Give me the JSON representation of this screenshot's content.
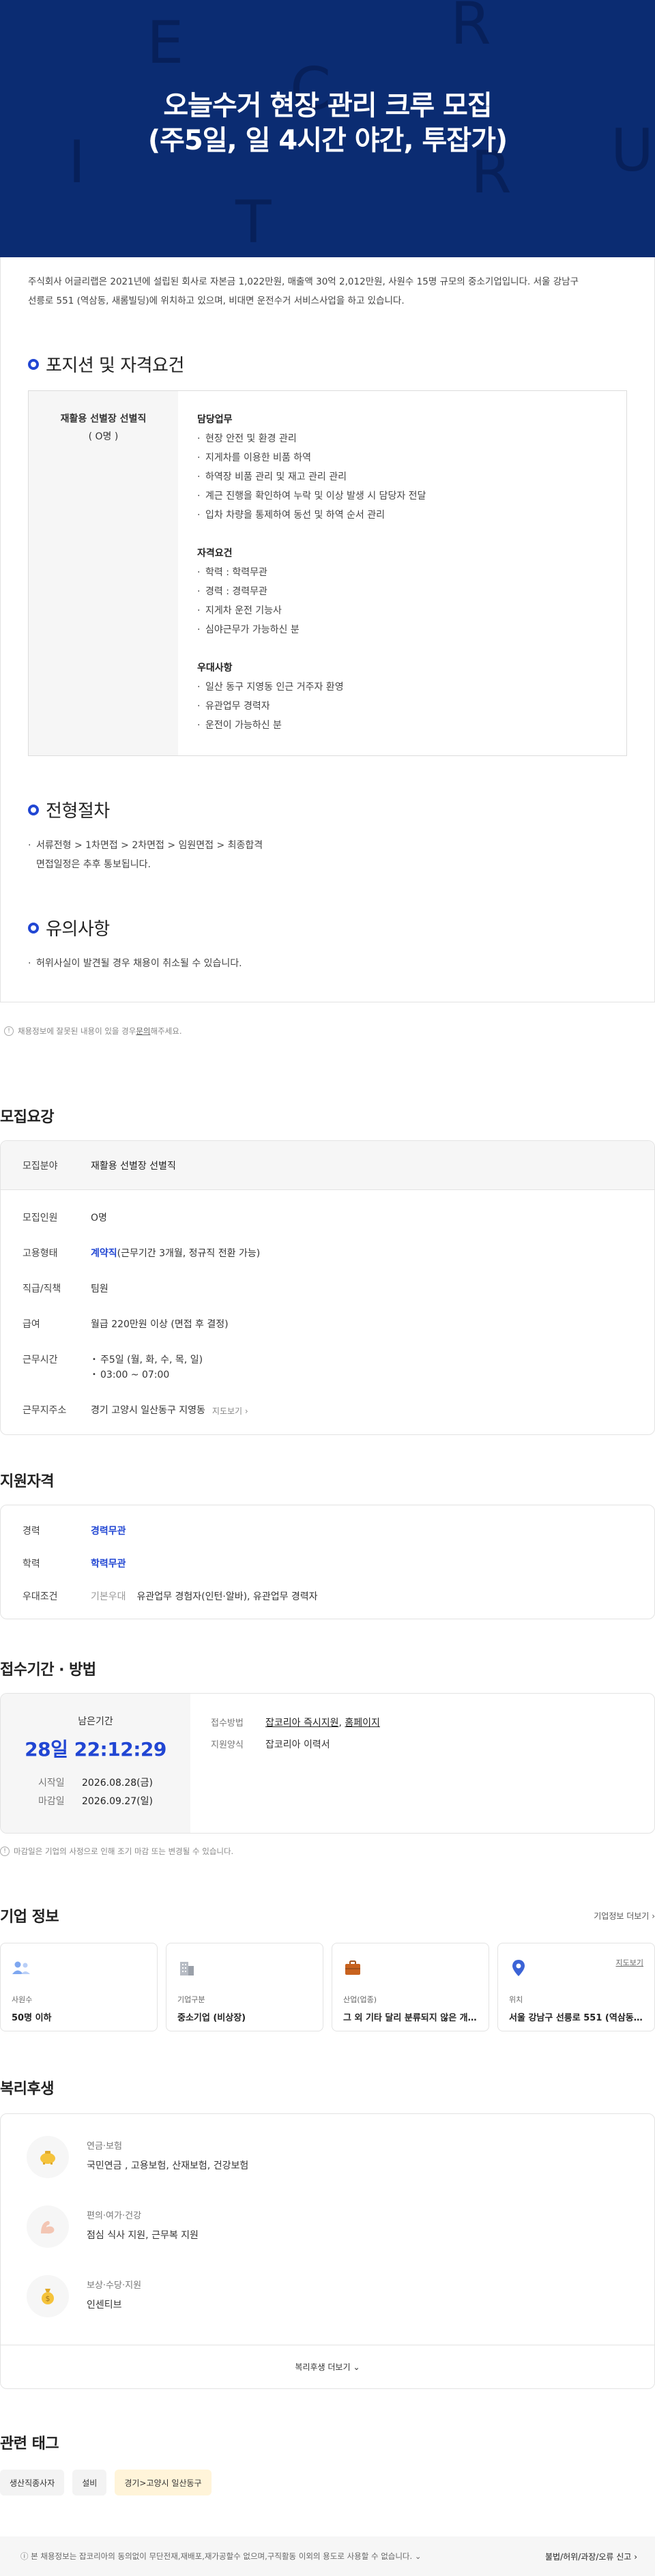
{
  "hero": {
    "title_line1": "오늘수거 현장 관리 크루 모집",
    "title_line2": "(주5일, 일 4시간 야간, 투잡가)",
    "deco_letters": [
      "E",
      "R",
      "C",
      "U",
      "I",
      "R",
      "T"
    ],
    "colors": {
      "background": "#0b2c72",
      "letters": "#07205a"
    }
  },
  "intro": {
    "line1": "주식회사 어글리랩은 2021년에 설립된 회사로 자본금 1,022만원, 매출액 30억 2,012만원, 사원수 15명 규모의 중소기업입니다. 서울 강남구",
    "line2": "선릉로 551 (역삼동, 새롬빌딩)에 위치하고 있으며, 비대면 운전수거 서비스사업을 하고 있습니다."
  },
  "position": {
    "heading": "포지션 및 자격요건",
    "job_title": "재활용 선별장 선별직",
    "headcount": "( O명 )",
    "groups": [
      {
        "title": "담당업무",
        "items": [
          "현장 안전 및 환경 관리",
          "지게차를 이용한 비품 하역",
          "하역장 비품 관리 및 재고 관리 관리",
          "계근 진행을 확인하여 누락 및 이상 발생 시 담당자 전달",
          "입차 차량을 통제하여 동선 및 하역 순서 관리"
        ]
      },
      {
        "title": "자격요건",
        "items": [
          "학력 : 학력무관",
          "경력 : 경력무관",
          "지게차 운전 기능사",
          "심야근무가 가능하신 분"
        ]
      },
      {
        "title": "우대사항",
        "items": [
          "일산 동구 지영동 인근 거주자 환영",
          "유관업무 경력자",
          "운전이 가능하신 분"
        ]
      }
    ]
  },
  "process": {
    "heading": "전형절차",
    "items": [
      "서류전형 > 1차면접 > 2차면접 > 임원면접 > 최종합격",
      "면접일정은 추후 통보됩니다."
    ]
  },
  "notes": {
    "heading": "유의사항",
    "items": [
      "허위사실이 발견될 경우 채용이 취소될 수 있습니다."
    ]
  },
  "report_tip": {
    "icon": "!",
    "before": "채용정보에 잘못된 내용이 있을 경우 ",
    "link": "문의",
    "after": "해주세요."
  },
  "recruit": {
    "heading": "모집요강",
    "field_key": "모집분야",
    "field_value": "재활용 선별장 선별직",
    "rows": {
      "headcount_key": "모집인원",
      "headcount_value": "O명",
      "type_key": "고용형태",
      "type_highlight": "계약직",
      "type_rest": "(근무기간 3개월, 정규직 전환 가능)",
      "rank_key": "직급/직책",
      "rank_value": "팀원",
      "salary_key": "급여",
      "salary_value": "월급 220만원 이상 (면접 후 결정)",
      "time_key": "근무시간",
      "time_line1": "주5일 (월, 화, 수, 목, 일)",
      "time_line2": "03:00 ~ 07:00",
      "addr_key": "근무지주소",
      "addr_value": "경기 고양시 일산동구 지영동",
      "addr_map": "지도보기"
    }
  },
  "qualification": {
    "heading": "지원자격",
    "career_key": "경력",
    "career_value": "경력무관",
    "edu_key": "학력",
    "edu_value": "학력무관",
    "pref_key": "우대조건",
    "pref_tag": "기본우대",
    "pref_value": "유관업무 경험자(인턴·알바), 유관업무 경력자"
  },
  "apply": {
    "heading": "접수기간 · 방법",
    "remain_label": "남은기간",
    "remain_value": "28일 22:12:29",
    "start_key": "시작일",
    "start_value": "2026.08.28(금)",
    "end_key": "마감일",
    "end_value": "2026.09.27(일)",
    "method_key": "접수방법",
    "method_link1": "잡코리아 즉시지원",
    "method_sep": ", ",
    "method_link2": "홈페이지",
    "form_key": "지원양식",
    "form_value": "잡코리아 이력서",
    "tip": "마감일은 기업의 사정으로 인해 조기 마감 또는 변경될 수 있습니다."
  },
  "company": {
    "heading": "기업 정보",
    "more": "기업정보 더보기",
    "cards": [
      {
        "label": "사원수",
        "value": "50명 이하",
        "icon": "people-icon"
      },
      {
        "label": "기업구분",
        "value": "중소기업 (비상장)",
        "icon": "building-icon"
      },
      {
        "label": "산업(업종)",
        "value": "그 외 기타 달리 분류되지 않은 개...",
        "icon": "briefcase-icon"
      },
      {
        "label": "위치",
        "value": "서울 강남구 선릉로 551 (역삼동,...",
        "icon": "location-pin-icon",
        "link": "지도보기"
      }
    ]
  },
  "welfare": {
    "heading": "복리후생",
    "items": [
      {
        "category": "연금·보험",
        "value": "국민연금 , 고용보험, 산재보험, 건강보험",
        "icon": "piggy-bank-icon"
      },
      {
        "category": "편의·여가·건강",
        "value": "점심 식사 지원, 근무복 지원",
        "icon": "arm-icon"
      },
      {
        "category": "보상·수당·지원",
        "value": "인센티브",
        "icon": "money-bag-icon"
      }
    ],
    "more": "복리후생 더보기"
  },
  "tags": {
    "heading": "관련 태그",
    "items": [
      "생산직종사자",
      "설비",
      "경기>고양시 일산동구"
    ]
  },
  "footer": {
    "notice": "본 채용정보는 잡코리아의 동의없이 무단전재,재배포,재가공할수 없으며,구직활동 이외의 용도로 사용할 수 없습니다.",
    "report": "불법/허위/과장/오류 신고"
  }
}
